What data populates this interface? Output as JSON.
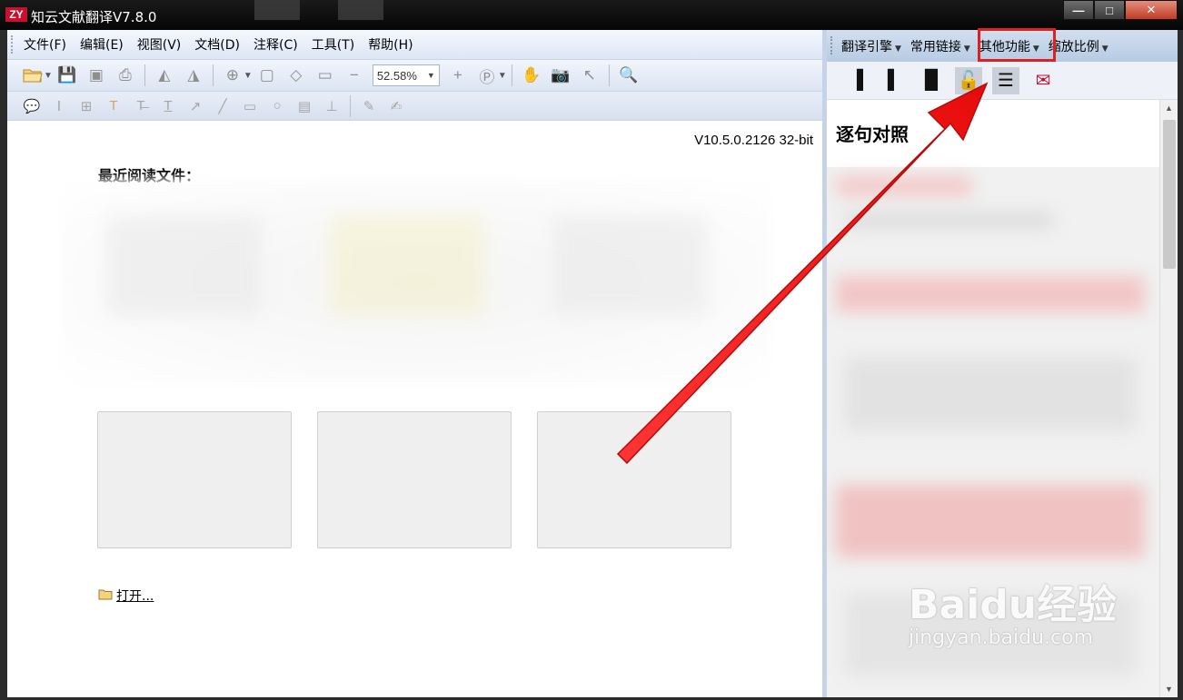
{
  "window": {
    "title": "知云文献翻译V7.8.0",
    "logo_text": "ZY",
    "controls": {
      "minimize": "—",
      "maximize": "□",
      "close": "✕"
    }
  },
  "menubar": {
    "items": [
      "文件(F)",
      "编辑(E)",
      "视图(V)",
      "文档(D)",
      "注释(C)",
      "工具(T)",
      "帮助(H)"
    ]
  },
  "toolbar": {
    "zoom_value": "52.58%"
  },
  "document": {
    "version": "V10.5.0.2126 32-bit",
    "recent_title": "最近阅读文件：",
    "open_link": "打开..."
  },
  "right_panel": {
    "menu": [
      {
        "label": "翻译引擎"
      },
      {
        "label": "常用链接"
      },
      {
        "label": "其他功能"
      },
      {
        "label": "缩放比例"
      }
    ],
    "highlighted_menu": "其他功能",
    "title": "逐句对照"
  },
  "watermark": {
    "brand": "Baidu经验",
    "url": "jingyan.baidu.com"
  },
  "colors": {
    "annotation_red": "#e02020",
    "brand_red": "#c8102e"
  }
}
